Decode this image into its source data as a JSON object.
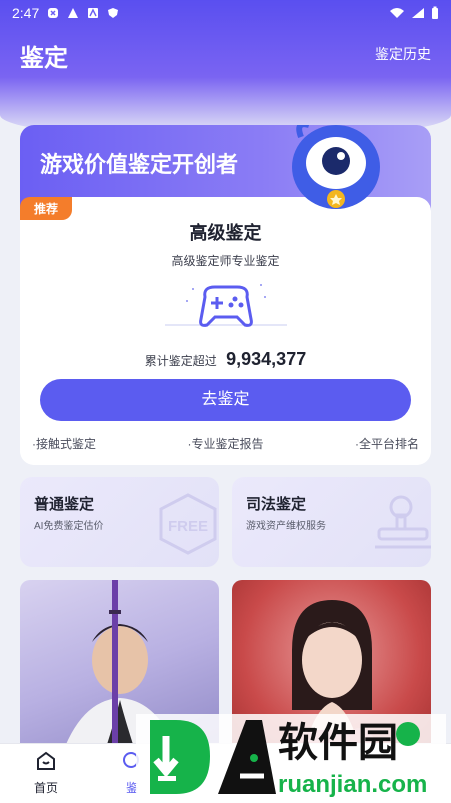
{
  "status_bar": {
    "time": "2:47"
  },
  "header": {
    "title": "鉴定",
    "history_link": "鉴定历史"
  },
  "hero": {
    "slogan": "游戏价值鉴定开创者",
    "badge": "推荐",
    "level_title": "高级鉴定",
    "level_subtitle": "高级鉴定师专业鉴定",
    "count_label": "累计鉴定超过",
    "count_value": "9,934,377",
    "cta_label": "去鉴定",
    "features": [
      "·接触式鉴定",
      "·专业鉴定报告",
      "·全平台排名"
    ]
  },
  "cards": [
    {
      "title": "普通鉴定",
      "subtitle": "AI免费鉴定估价",
      "deco_text": "FREE"
    },
    {
      "title": "司法鉴定",
      "subtitle": "游戏资产维权服务"
    }
  ],
  "bottom_nav": {
    "home_label": "首页",
    "second_label": "鉴"
  },
  "watermark": {
    "brand_cn": "软件园",
    "brand_url": "ruanjian.com"
  },
  "colors": {
    "accent": "#5b5cf0",
    "badge": "#f47d2b"
  },
  "icons": {
    "mascot": "blue-monster-mascot-icon",
    "controller": "gamepad-icon",
    "home": "home-icon",
    "search": "search-icon"
  }
}
